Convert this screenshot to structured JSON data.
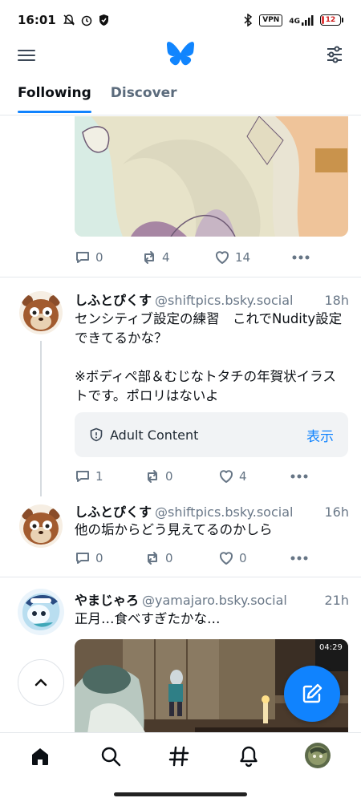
{
  "status_bar": {
    "time": "16:01",
    "vpn": "VPN",
    "network": "4G",
    "battery": "12"
  },
  "tabs": [
    {
      "label": "Following",
      "active": true
    },
    {
      "label": "Discover",
      "active": false
    }
  ],
  "posts": [
    {
      "replies": "0",
      "reposts": "4",
      "likes": "14"
    },
    {
      "author": "しふとぴくす",
      "handle": "@shiftpics.bsky.social",
      "time": "18h",
      "text": "センシティブ設定の練習　これでNudity設定できてるかな？\n\n※ボディペ部＆むじなトタチの年賀状イラストです。ポロリはないよ",
      "warning_label": "Adult Content",
      "warning_action": "表示",
      "replies": "1",
      "reposts": "0",
      "likes": "4"
    },
    {
      "author": "しふとぴくす",
      "handle": "@shiftpics.bsky.social",
      "time": "16h",
      "text": "他の垢からどう見えてるのかしら",
      "replies": "0",
      "reposts": "0",
      "likes": "0"
    },
    {
      "author": "やまじゃろ",
      "handle": "@yamajaro.bsky.social",
      "time": "21h",
      "text": "正月…食べすぎたかな…",
      "image_overlay_time": "04:29"
    }
  ],
  "colors": {
    "accent": "#1083fe",
    "muted": "#667585",
    "divider": "#e5e8ec"
  }
}
